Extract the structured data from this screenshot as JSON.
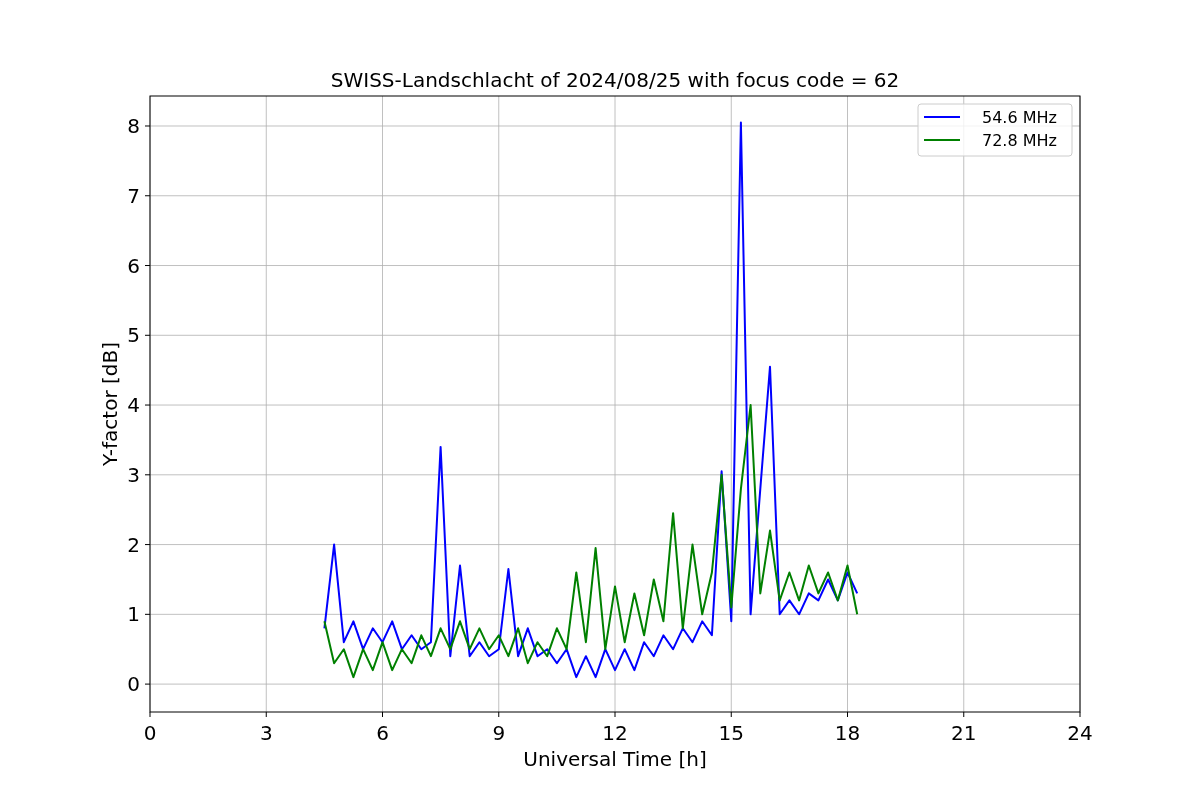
{
  "chart_data": {
    "type": "line",
    "title": "SWISS-Landschlacht of 2024/08/25 with focus code = 62",
    "xlabel": "Universal Time [h]",
    "ylabel": "Y-factor [dB]",
    "x": [
      4.5,
      4.75,
      5,
      5.25,
      5.5,
      5.75,
      6,
      6.25,
      6.5,
      6.75,
      7,
      7.25,
      7.5,
      7.75,
      8,
      8.25,
      8.5,
      8.75,
      9,
      9.25,
      9.5,
      9.75,
      10,
      10.25,
      10.5,
      10.75,
      11,
      11.25,
      11.5,
      11.75,
      12,
      12.25,
      12.5,
      12.75,
      13,
      13.25,
      13.5,
      13.75,
      14,
      14.25,
      14.5,
      14.75,
      15,
      15.25,
      15.5,
      15.75,
      16,
      16.25,
      16.5,
      16.75,
      17,
      17.25,
      17.5,
      17.75,
      18,
      18.25
    ],
    "series": [
      {
        "name": "54.6 MHz",
        "color": "#0000ff",
        "values": [
          0.8,
          2.0,
          0.6,
          0.9,
          0.5,
          0.8,
          0.6,
          0.9,
          0.5,
          0.7,
          0.5,
          0.6,
          3.4,
          0.4,
          1.7,
          0.4,
          0.6,
          0.4,
          0.5,
          1.65,
          0.4,
          0.8,
          0.4,
          0.5,
          0.3,
          0.5,
          0.1,
          0.4,
          0.1,
          0.5,
          0.2,
          0.5,
          0.2,
          0.6,
          0.4,
          0.7,
          0.5,
          0.8,
          0.6,
          0.9,
          0.7,
          3.05,
          0.9,
          8.05,
          1.0,
          2.8,
          4.55,
          1.0,
          1.2,
          1.0,
          1.3,
          1.2,
          1.5,
          1.2,
          1.6,
          1.3
        ]
      },
      {
        "name": "72.8 MHz",
        "color": "#008000",
        "values": [
          0.9,
          0.3,
          0.5,
          0.1,
          0.5,
          0.2,
          0.6,
          0.2,
          0.5,
          0.3,
          0.7,
          0.4,
          0.8,
          0.5,
          0.9,
          0.5,
          0.8,
          0.5,
          0.7,
          0.4,
          0.8,
          0.3,
          0.6,
          0.4,
          0.8,
          0.5,
          1.6,
          0.6,
          1.95,
          0.5,
          1.4,
          0.6,
          1.3,
          0.7,
          1.5,
          0.9,
          2.45,
          0.8,
          2.0,
          1.0,
          1.6,
          3.0,
          1.1,
          2.8,
          4.0,
          1.3,
          2.2,
          1.2,
          1.6,
          1.2,
          1.7,
          1.3,
          1.6,
          1.2,
          1.7,
          1.0
        ]
      }
    ],
    "grid": true,
    "legend": "upper right",
    "xlim": [
      0,
      24
    ],
    "ylim": [
      -0.4,
      8.43
    ],
    "xticks": [
      {
        "value": 0,
        "label": "0"
      },
      {
        "value": 3,
        "label": "3"
      },
      {
        "value": 6,
        "label": "6"
      },
      {
        "value": 9,
        "label": "9"
      },
      {
        "value": 12,
        "label": "12"
      },
      {
        "value": 15,
        "label": "15"
      },
      {
        "value": 18,
        "label": "18"
      },
      {
        "value": 21,
        "label": "21"
      },
      {
        "value": 24,
        "label": "24"
      }
    ],
    "yticks": [
      {
        "value": 0,
        "label": "0"
      },
      {
        "value": 1,
        "label": "1"
      },
      {
        "value": 2,
        "label": "2"
      },
      {
        "value": 3,
        "label": "3"
      },
      {
        "value": 4,
        "label": "4"
      },
      {
        "value": 5,
        "label": "5"
      },
      {
        "value": 6,
        "label": "6"
      },
      {
        "value": 7,
        "label": "7"
      },
      {
        "value": 8,
        "label": "8"
      }
    ]
  }
}
